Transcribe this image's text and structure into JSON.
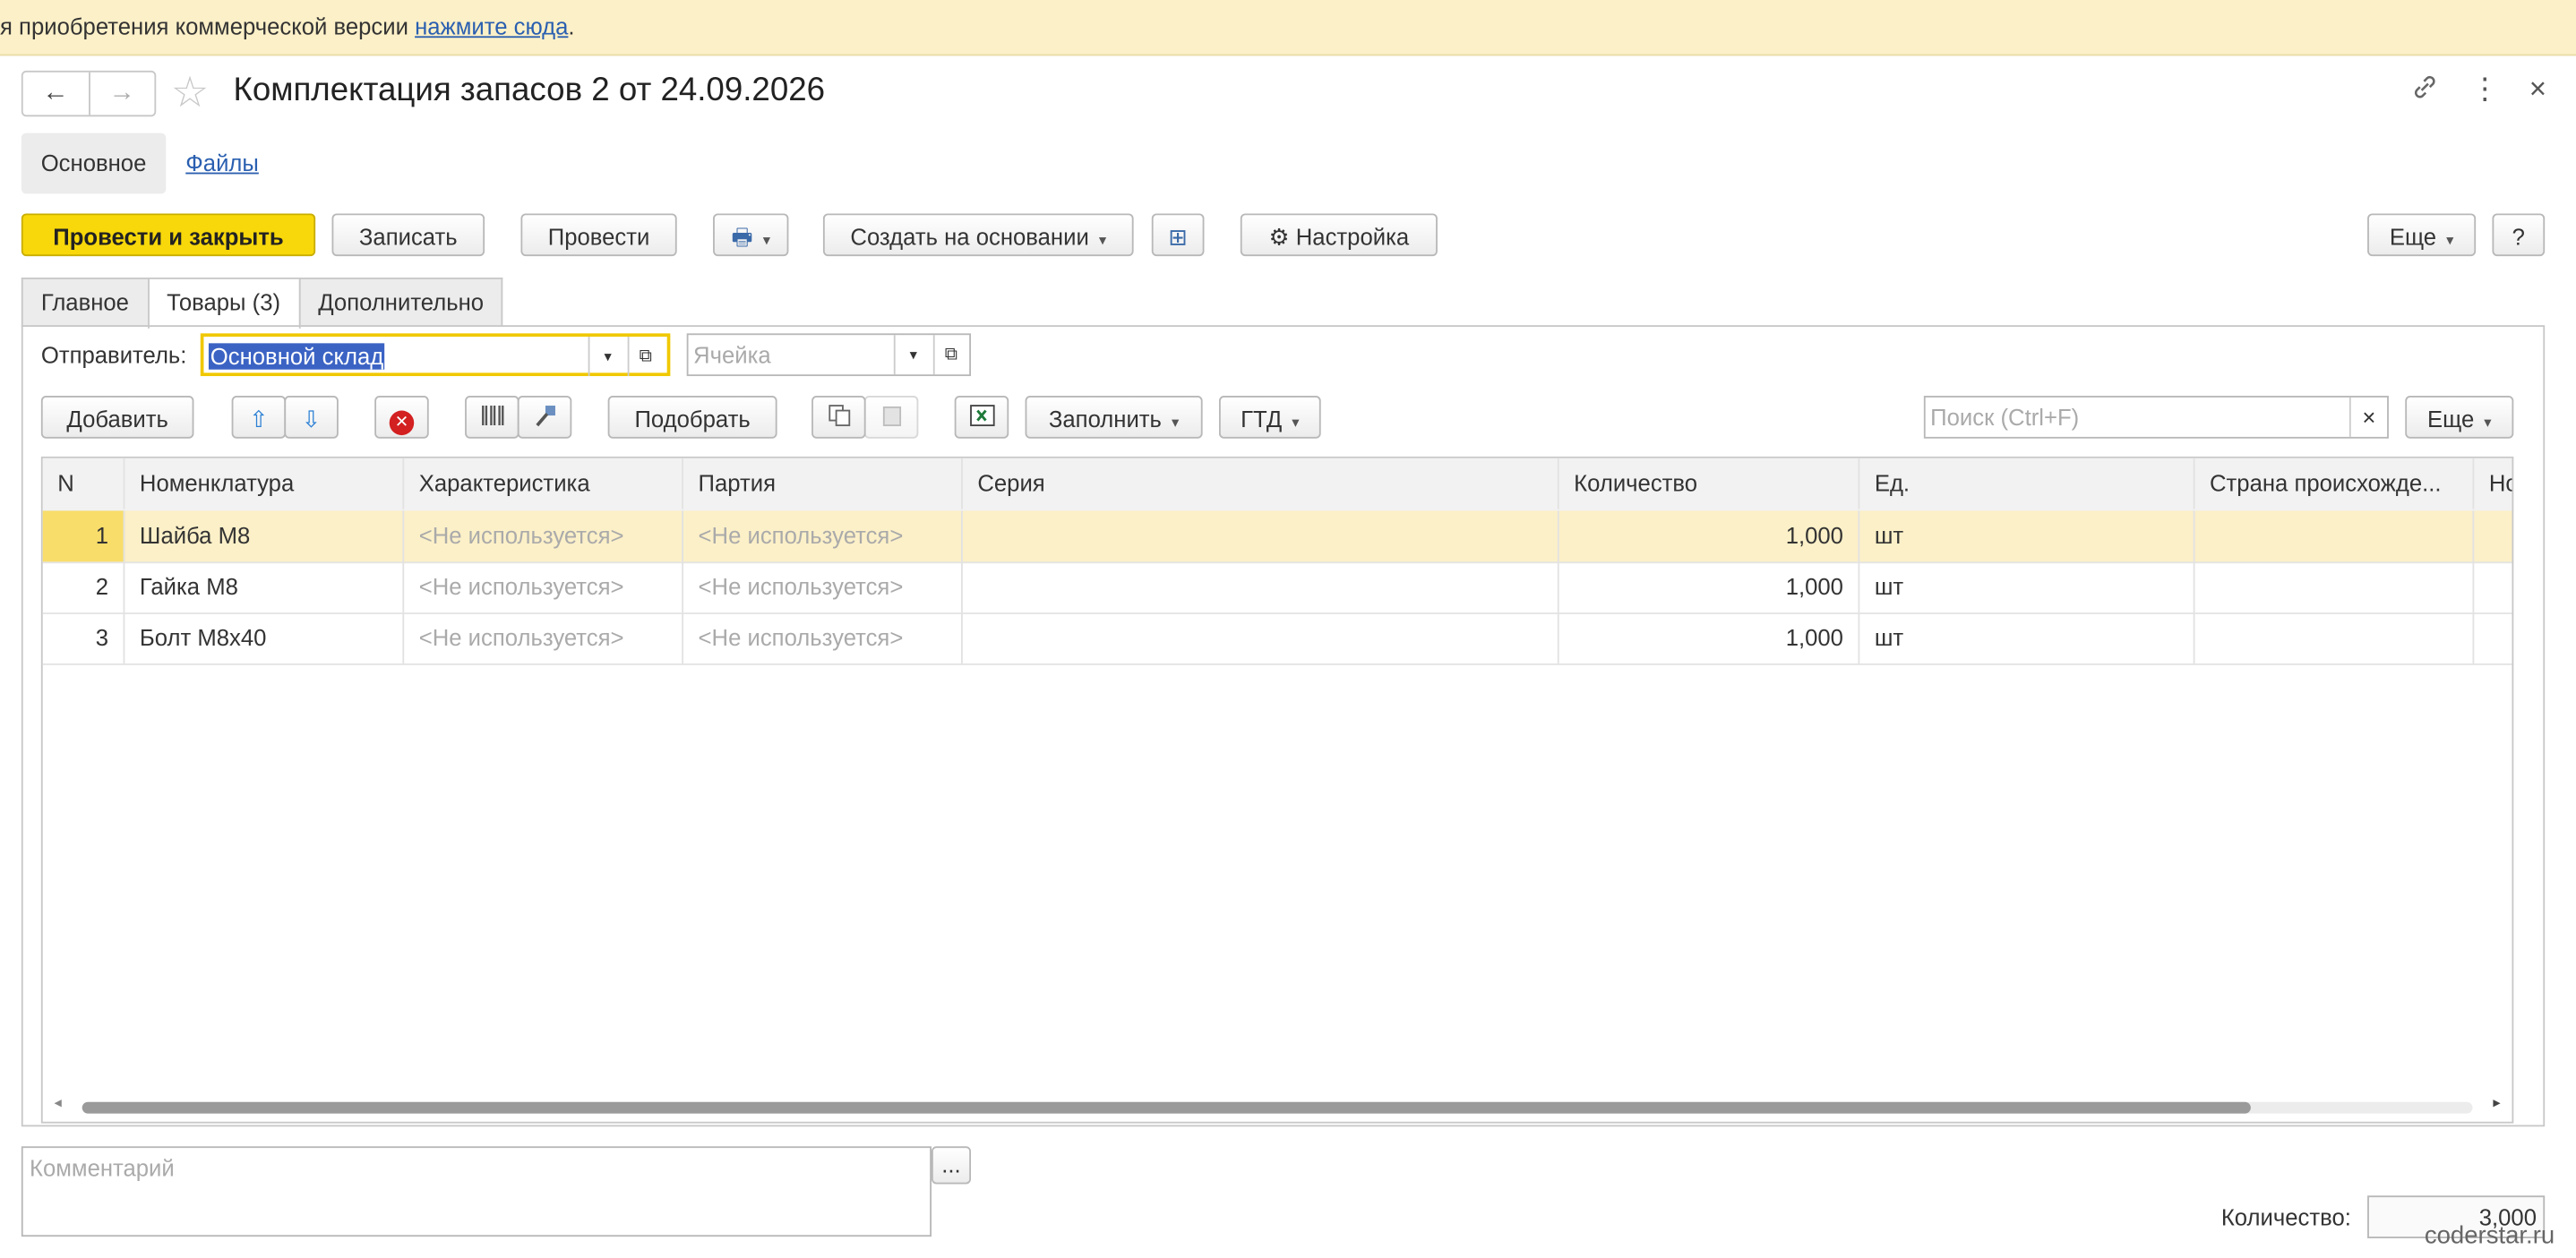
{
  "banner": {
    "text": "я приобретения коммерческой версии ",
    "link": "нажмите сюда",
    "tail": "."
  },
  "window": {
    "title": "Комплектация запасов 2 от 24.09.2026",
    "back_icon": "←",
    "forward_icon": "→",
    "star_icon": "☆",
    "link_icon": "🔗",
    "more_icon": "⋮",
    "close_icon": "×"
  },
  "subnav": {
    "main": "Основное",
    "files": "Файлы"
  },
  "toolbar": {
    "post_close": "Провести и закрыть",
    "save": "Записать",
    "post": "Провести",
    "print_icon": "🖶",
    "create_based": "Создать на основании",
    "structure_icon": "⊞",
    "settings_icon": "⚙",
    "settings": "Настройка",
    "more": "Еще",
    "help": "?"
  },
  "tabs": [
    "Главное",
    "Товары (3)",
    "Дополнительно"
  ],
  "sender": {
    "label": "Отправитель:",
    "value": "Основной склад",
    "cell_placeholder": "Ячейка"
  },
  "table_toolbar": {
    "add": "Добавить",
    "up_icon": "⇧",
    "down_icon": "⇩",
    "delete_icon": "✕",
    "pick": "Подобрать",
    "fill": "Заполнить",
    "gtd": "ГТД",
    "search_placeholder": "Поиск (Ctrl+F)",
    "search_clear": "×",
    "more": "Еще"
  },
  "table": {
    "columns": [
      "N",
      "Номенклатура",
      "Характеристика",
      "Партия",
      "Серия",
      "Количество",
      "Ед.",
      "Страна происхожде...",
      "Но"
    ],
    "rows": [
      {
        "n": "1",
        "item": "Шайба М8",
        "char": "<Не используется>",
        "batch": "<Не используется>",
        "series": "",
        "qty": "1,000",
        "unit": "шт",
        "country": ""
      },
      {
        "n": "2",
        "item": "Гайка М8",
        "char": "<Не используется>",
        "batch": "<Не используется>",
        "series": "",
        "qty": "1,000",
        "unit": "шт",
        "country": ""
      },
      {
        "n": "3",
        "item": "Болт М8х40",
        "char": "<Не используется>",
        "batch": "<Не используется>",
        "series": "",
        "qty": "1,000",
        "unit": "шт",
        "country": ""
      }
    ]
  },
  "footer": {
    "comment_placeholder": "Комментарий",
    "comment_btn": "...",
    "qty_label": "Количество:",
    "qty_value": "3,000",
    "watermark": "coderstar.ru"
  }
}
